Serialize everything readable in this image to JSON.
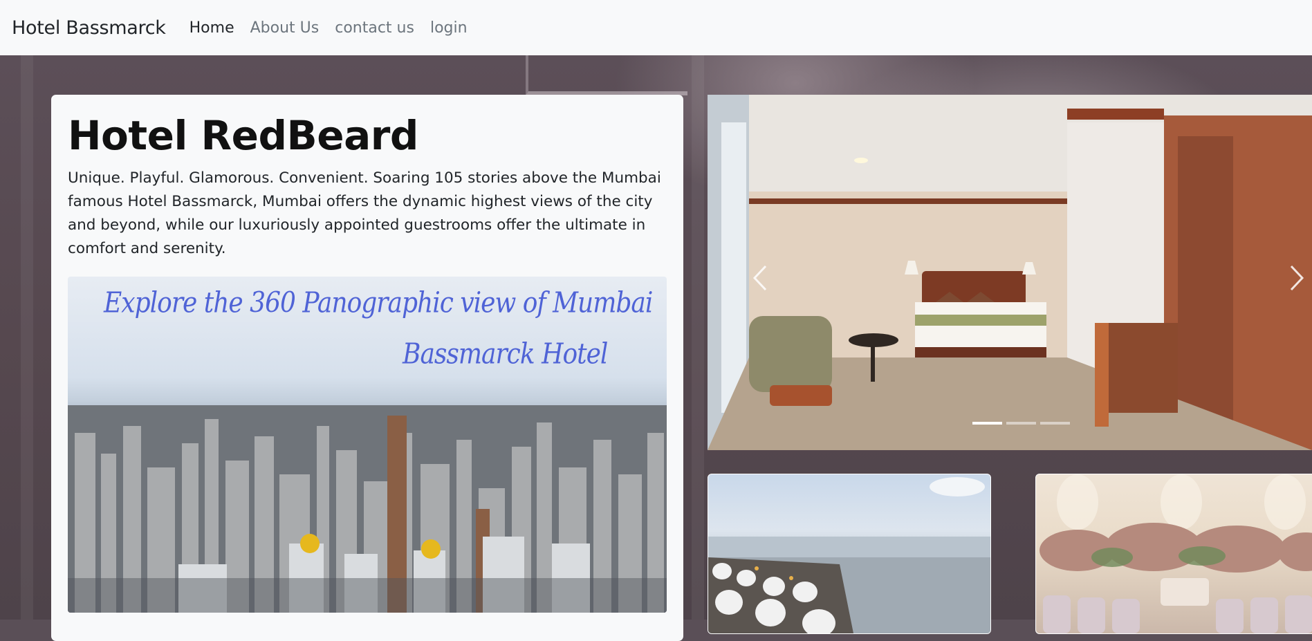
{
  "navbar": {
    "brand": "Hotel Bassmarck",
    "links": [
      {
        "label": "Home",
        "active": true
      },
      {
        "label": "About Us",
        "active": false
      },
      {
        "label": "contact us",
        "active": false
      },
      {
        "label": "login",
        "active": false
      }
    ]
  },
  "intro": {
    "title": "Hotel RedBeard",
    "description": "Unique. Playful. Glamorous. Convenient. Soaring 105 stories above the Mumbai famous Hotel Bassmarck, Mumbai offers the dynamic highest views of the city and beyond, while our luxuriously appointed guestrooms offer the ultimate in comfort and serenity."
  },
  "panorama": {
    "line1": "Explore the 360 Panographic view of Mumbai",
    "line2": "Bassmarck Hotel"
  },
  "carousel": {
    "slide_count": 3,
    "active_index": 0
  },
  "thumbnails": [
    {
      "name": "rooftop-dining-image"
    },
    {
      "name": "banquet-hall-image"
    }
  ],
  "colors": {
    "navbar_bg": "#f8f9fa",
    "page_bg": "#5a4f57",
    "script_text": "#4f63d6"
  }
}
